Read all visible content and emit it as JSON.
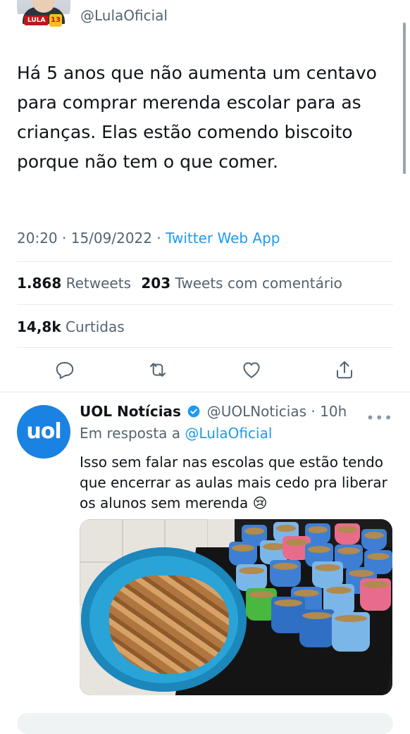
{
  "header": {
    "handle": "@LulaOficial",
    "avatar_badge": "LULA",
    "avatar_badge_number": "13"
  },
  "tweet": {
    "text": "Há 5 anos que não aumenta um centavo para comprar merenda escolar para as crianças. Elas estão comendo biscoito porque não tem o que comer.",
    "time": "20:20",
    "date": "15/09/2022",
    "source": "Twitter Web App",
    "retweets_count": "1.868",
    "retweets_label": "Retweets",
    "quotes_count": "203",
    "quotes_label": "Tweets com comentário",
    "likes_count": "14,8k",
    "likes_label": "Curtidas"
  },
  "actions": [
    {
      "icon": "reply-icon"
    },
    {
      "icon": "retweet-icon"
    },
    {
      "icon": "like-icon"
    },
    {
      "icon": "share-icon"
    }
  ],
  "reply": {
    "avatar_text": "uol",
    "name": "UOL Notícias",
    "handle": "@UOLNoticias",
    "time": "10h",
    "more_label": "•••",
    "reply_prefix": "Em resposta a",
    "reply_mention": "@LulaOficial",
    "text": "Isso sem falar nas escolas que estão tendo que encerrar as aulas mais cedo pra liberar os alunos sem merenda 😢"
  },
  "colors": {
    "accent": "#1d9bf0",
    "secondary_text": "#536471",
    "uol_blue": "#1a82e2"
  }
}
